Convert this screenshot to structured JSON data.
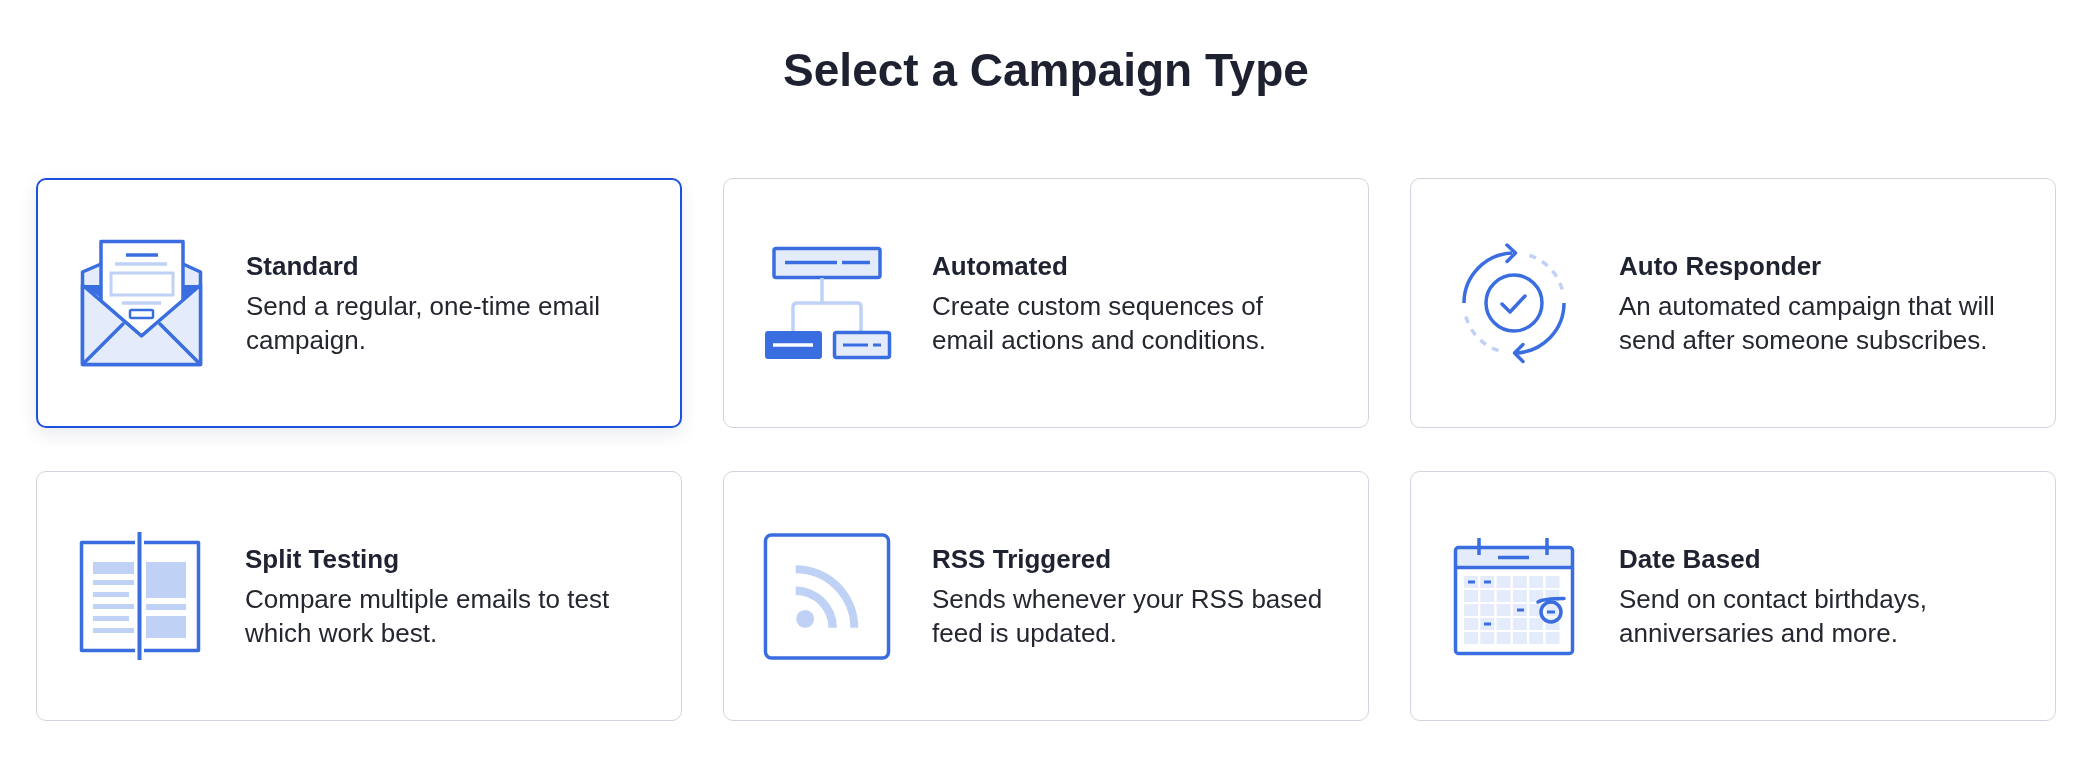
{
  "heading": "Select a Campaign Type",
  "cards": [
    {
      "title": "Standard",
      "description": "Send a regular, one-time email\ncampaign.",
      "selected": true
    },
    {
      "title": "Automated",
      "description": "Create custom sequences of\nemail actions and conditions.",
      "selected": false
    },
    {
      "title": "Auto Responder",
      "description": "An automated campaign that will\nsend after someone subscribes.",
      "selected": false
    },
    {
      "title": "Split Testing",
      "description": "Compare multiple emails to test\nwhich work best.",
      "selected": false
    },
    {
      "title": "RSS Triggered",
      "description": "Sends whenever your RSS based\nfeed is updated.",
      "selected": false
    },
    {
      "title": "Date Based",
      "description": "Send on contact birthdays,\nanniversaries and more.",
      "selected": false
    }
  ]
}
